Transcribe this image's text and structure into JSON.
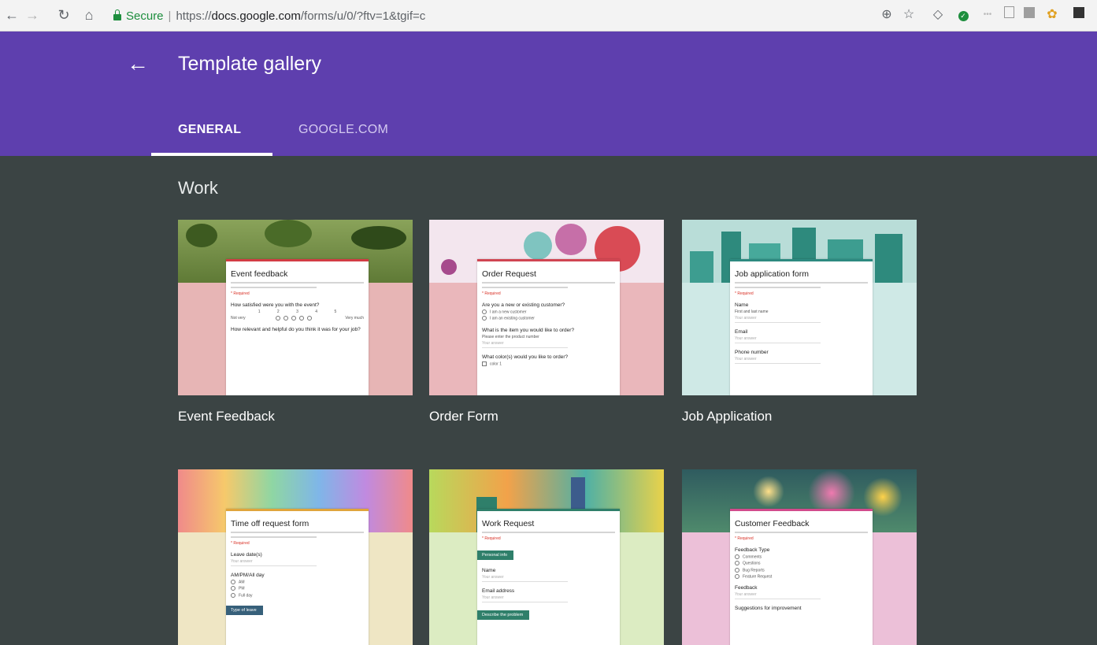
{
  "browser": {
    "secure_label": "Secure",
    "url_scheme": "https://",
    "url_host": "docs.google.com",
    "url_path": "/forms/u/0/?ftv=1&tgif=c"
  },
  "header": {
    "title": "Template gallery",
    "tabs": [
      {
        "label": "GENERAL",
        "active": true
      },
      {
        "label": "GOOGLE.COM",
        "active": false
      }
    ],
    "color": "#5e3fae"
  },
  "section": {
    "title": "Work"
  },
  "templates": [
    {
      "label": "Event Feedback",
      "form_title": "Event feedback",
      "accent": "#d23c44",
      "q1": "How satisfied were you with the event?",
      "scale": [
        "1",
        "2",
        "3",
        "4",
        "5"
      ],
      "low": "Not very",
      "high": "Very much",
      "q2": "How relevant and helpful do you think it was for your job?"
    },
    {
      "label": "Order Form",
      "form_title": "Order Request",
      "accent": "#d04552",
      "q1": "Are you a new or existing customer?",
      "opts": [
        "I am a new customer",
        "I am an existing customer"
      ],
      "q2": "What is the item you would like to order?",
      "q2_hint": "Please enter the product number",
      "q3": "What color(s) would you like to order?",
      "q3_opt": "color 1"
    },
    {
      "label": "Job Application",
      "form_title": "Job application form",
      "accent": "#2d8a80",
      "fields": [
        "Name",
        "Email",
        "Phone number"
      ],
      "name_hint": "First and last name"
    },
    {
      "label": "Time off request form",
      "form_title": "Time off request form",
      "accent": "#e0a53c",
      "q1": "Leave date(s)",
      "q2": "AM/PM/All day",
      "opts": [
        "AM",
        "PM",
        "Full day"
      ],
      "ribbon": "Type of leave"
    },
    {
      "label": "Work Request",
      "form_title": "Work Request",
      "accent": "#2f7f6a",
      "ribbon1": "Personal info",
      "fields": [
        "Name",
        "Email address"
      ],
      "ribbon2": "Describe the problem"
    },
    {
      "label": "Customer Feedback",
      "form_title": "Customer Feedback",
      "accent": "#d24b8c",
      "q1": "Feedback Type",
      "opts": [
        "Comments",
        "Questions",
        "Bug Reports",
        "Feature Request"
      ],
      "q2": "Feedback",
      "q3": "Suggestions for improvement"
    }
  ],
  "common": {
    "required": "* Required",
    "your_answer": "Your answer"
  },
  "icons": [
    "back-arrow-icon",
    "forward-arrow-icon",
    "reload-icon",
    "home-icon",
    "lock-icon",
    "zoom-icon",
    "star-icon",
    "extension-icon"
  ]
}
